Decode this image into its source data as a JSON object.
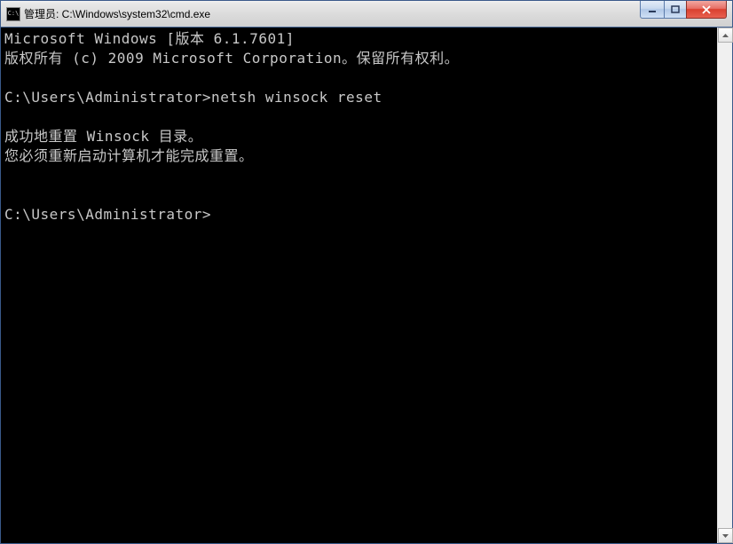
{
  "window": {
    "title": "管理员: C:\\Windows\\system32\\cmd.exe",
    "icon_text": "C:\\"
  },
  "terminal": {
    "lines": [
      "Microsoft Windows [版本 6.1.7601]",
      "版权所有 (c) 2009 Microsoft Corporation。保留所有权利。",
      "",
      "C:\\Users\\Administrator>netsh winsock reset",
      "",
      "成功地重置 Winsock 目录。",
      "您必须重新启动计算机才能完成重置。",
      "",
      "",
      "C:\\Users\\Administrator>"
    ]
  }
}
